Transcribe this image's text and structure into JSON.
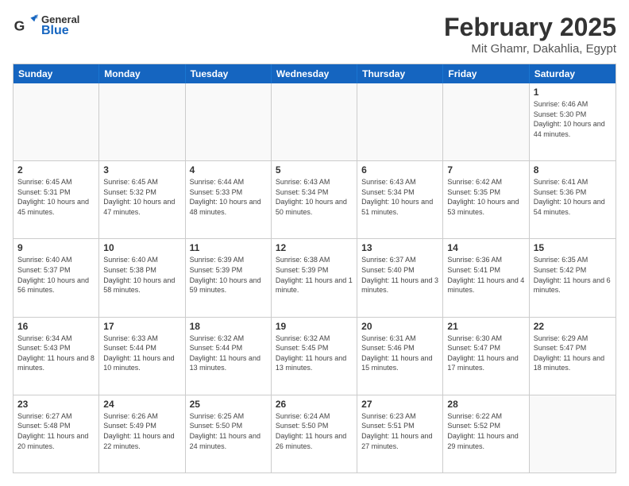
{
  "header": {
    "logo_general": "General",
    "logo_blue": "Blue",
    "month_year": "February 2025",
    "location": "Mit Ghamr, Dakahlia, Egypt"
  },
  "weekdays": [
    "Sunday",
    "Monday",
    "Tuesday",
    "Wednesday",
    "Thursday",
    "Friday",
    "Saturday"
  ],
  "rows": [
    [
      {
        "day": "",
        "empty": true
      },
      {
        "day": "",
        "empty": true
      },
      {
        "day": "",
        "empty": true
      },
      {
        "day": "",
        "empty": true
      },
      {
        "day": "",
        "empty": true
      },
      {
        "day": "",
        "empty": true
      },
      {
        "day": "1",
        "sunrise": "6:46 AM",
        "sunset": "5:30 PM",
        "daylight": "10 hours and 44 minutes."
      }
    ],
    [
      {
        "day": "2",
        "sunrise": "6:45 AM",
        "sunset": "5:31 PM",
        "daylight": "10 hours and 45 minutes."
      },
      {
        "day": "3",
        "sunrise": "6:45 AM",
        "sunset": "5:32 PM",
        "daylight": "10 hours and 47 minutes."
      },
      {
        "day": "4",
        "sunrise": "6:44 AM",
        "sunset": "5:33 PM",
        "daylight": "10 hours and 48 minutes."
      },
      {
        "day": "5",
        "sunrise": "6:43 AM",
        "sunset": "5:34 PM",
        "daylight": "10 hours and 50 minutes."
      },
      {
        "day": "6",
        "sunrise": "6:43 AM",
        "sunset": "5:34 PM",
        "daylight": "10 hours and 51 minutes."
      },
      {
        "day": "7",
        "sunrise": "6:42 AM",
        "sunset": "5:35 PM",
        "daylight": "10 hours and 53 minutes."
      },
      {
        "day": "8",
        "sunrise": "6:41 AM",
        "sunset": "5:36 PM",
        "daylight": "10 hours and 54 minutes."
      }
    ],
    [
      {
        "day": "9",
        "sunrise": "6:40 AM",
        "sunset": "5:37 PM",
        "daylight": "10 hours and 56 minutes."
      },
      {
        "day": "10",
        "sunrise": "6:40 AM",
        "sunset": "5:38 PM",
        "daylight": "10 hours and 58 minutes."
      },
      {
        "day": "11",
        "sunrise": "6:39 AM",
        "sunset": "5:39 PM",
        "daylight": "10 hours and 59 minutes."
      },
      {
        "day": "12",
        "sunrise": "6:38 AM",
        "sunset": "5:39 PM",
        "daylight": "11 hours and 1 minute."
      },
      {
        "day": "13",
        "sunrise": "6:37 AM",
        "sunset": "5:40 PM",
        "daylight": "11 hours and 3 minutes."
      },
      {
        "day": "14",
        "sunrise": "6:36 AM",
        "sunset": "5:41 PM",
        "daylight": "11 hours and 4 minutes."
      },
      {
        "day": "15",
        "sunrise": "6:35 AM",
        "sunset": "5:42 PM",
        "daylight": "11 hours and 6 minutes."
      }
    ],
    [
      {
        "day": "16",
        "sunrise": "6:34 AM",
        "sunset": "5:43 PM",
        "daylight": "11 hours and 8 minutes."
      },
      {
        "day": "17",
        "sunrise": "6:33 AM",
        "sunset": "5:44 PM",
        "daylight": "11 hours and 10 minutes."
      },
      {
        "day": "18",
        "sunrise": "6:32 AM",
        "sunset": "5:44 PM",
        "daylight": "11 hours and 13 minutes."
      },
      {
        "day": "19",
        "sunrise": "6:32 AM",
        "sunset": "5:45 PM",
        "daylight": "11 hours and 13 minutes."
      },
      {
        "day": "20",
        "sunrise": "6:31 AM",
        "sunset": "5:46 PM",
        "daylight": "11 hours and 15 minutes."
      },
      {
        "day": "21",
        "sunrise": "6:30 AM",
        "sunset": "5:47 PM",
        "daylight": "11 hours and 17 minutes."
      },
      {
        "day": "22",
        "sunrise": "6:29 AM",
        "sunset": "5:47 PM",
        "daylight": "11 hours and 18 minutes."
      }
    ],
    [
      {
        "day": "23",
        "sunrise": "6:27 AM",
        "sunset": "5:48 PM",
        "daylight": "11 hours and 20 minutes."
      },
      {
        "day": "24",
        "sunrise": "6:26 AM",
        "sunset": "5:49 PM",
        "daylight": "11 hours and 22 minutes."
      },
      {
        "day": "25",
        "sunrise": "6:25 AM",
        "sunset": "5:50 PM",
        "daylight": "11 hours and 24 minutes."
      },
      {
        "day": "26",
        "sunrise": "6:24 AM",
        "sunset": "5:50 PM",
        "daylight": "11 hours and 26 minutes."
      },
      {
        "day": "27",
        "sunrise": "6:23 AM",
        "sunset": "5:51 PM",
        "daylight": "11 hours and 27 minutes."
      },
      {
        "day": "28",
        "sunrise": "6:22 AM",
        "sunset": "5:52 PM",
        "daylight": "11 hours and 29 minutes."
      },
      {
        "day": "",
        "empty": true
      }
    ]
  ]
}
